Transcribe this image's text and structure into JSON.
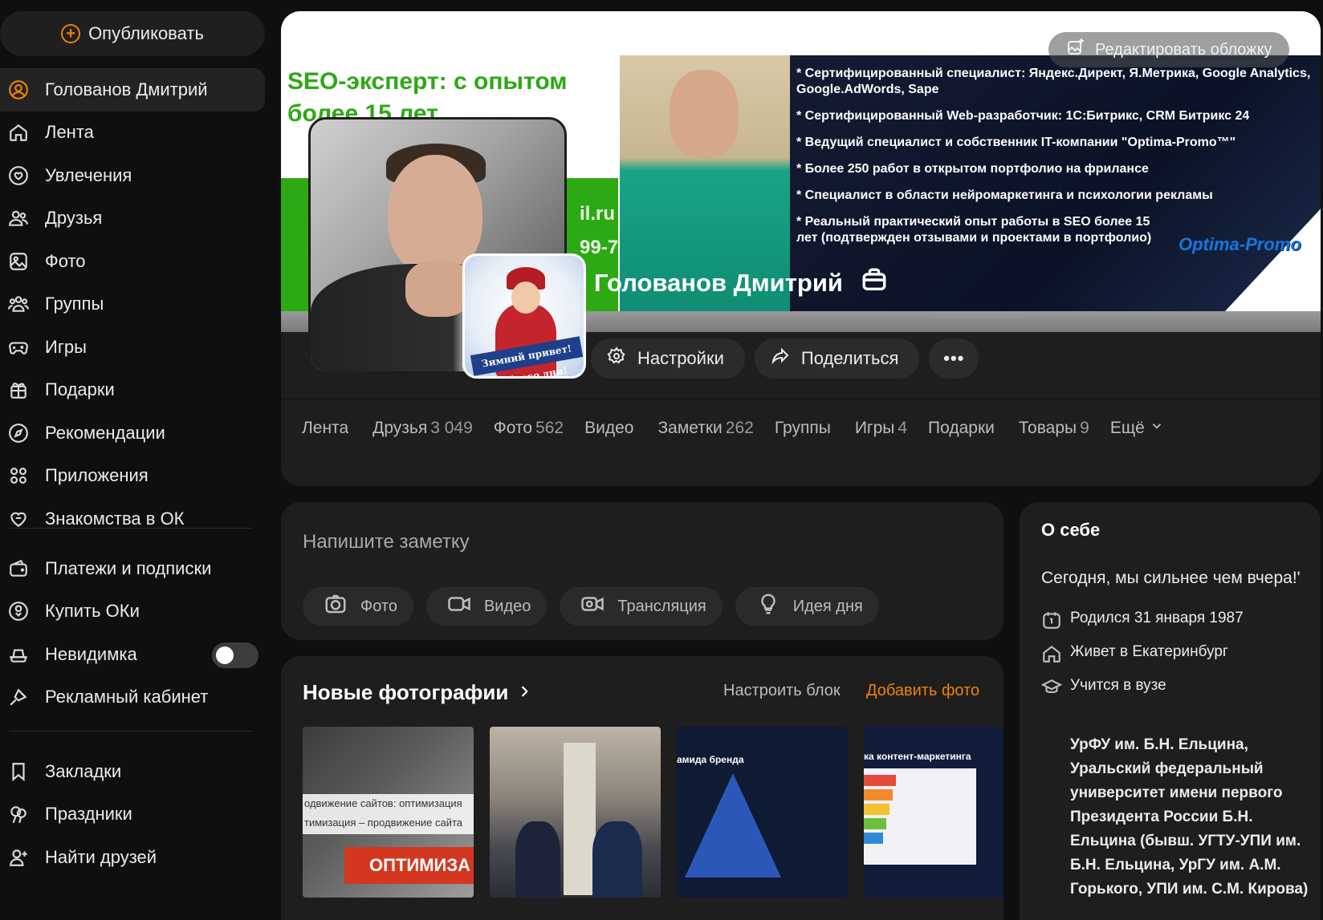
{
  "sidebar": {
    "publish_label": "Опубликовать",
    "items_main": [
      {
        "label": "Голованов Дмитрий",
        "icon": "user-icon"
      },
      {
        "label": "Лента",
        "icon": "home-icon"
      },
      {
        "label": "Увлечения",
        "icon": "hobbies-icon"
      },
      {
        "label": "Друзья",
        "icon": "friends-icon"
      },
      {
        "label": "Фото",
        "icon": "photo-icon"
      },
      {
        "label": "Группы",
        "icon": "groups-icon"
      },
      {
        "label": "Игры",
        "icon": "gamepad-icon"
      },
      {
        "label": "Подарки",
        "icon": "gift-icon"
      },
      {
        "label": "Рекомендации",
        "icon": "compass-icon"
      },
      {
        "label": "Приложения",
        "icon": "apps-icon"
      },
      {
        "label": "Знакомства в ОК",
        "icon": "dating-icon"
      }
    ],
    "items_services": [
      {
        "label": "Платежи и подписки",
        "icon": "wallet-icon"
      },
      {
        "label": "Купить ОКи",
        "icon": "coin-icon"
      },
      {
        "label": "Невидимка",
        "icon": "incognito-icon",
        "toggle_on": false
      },
      {
        "label": "Рекламный кабинет",
        "icon": "ads-icon"
      }
    ],
    "items_extra": [
      {
        "label": "Закладки",
        "icon": "bookmark-icon"
      },
      {
        "label": "Праздники",
        "icon": "balloons-icon"
      },
      {
        "label": "Найти друзей",
        "icon": "add-friend-icon"
      }
    ]
  },
  "cover": {
    "edit_label": "Редактировать обложку",
    "seo_title": "SEO-эксперт: с опытом более 15 лет",
    "email_fragment": "il.ru",
    "phone_fragment": "99-7",
    "bullets_1": "* Сертифицированный специалист: Яндекс.Директ, Я.Метрика, Google Analytics, Google.AdWords, Sape",
    "bullets_2": "* Сертифицированный Web-разработчик: 1С:Битрикс, CRM Битрикс 24",
    "bullets_3": "* Ведущий специалист и собственник IT-компании \"Optima-Promo™\"",
    "bullets_4": "* Более 250 работ в открытом портфолио на фрилансе",
    "bullets_5": "* Специалист в области нейромаркетинга и психологии рекламы",
    "bullets_6": "* Реальный практический опыт работы в SEO более 15 лет (подтвержден отзывами и проектами в портфолио)",
    "logo_text": "Optima-Promo",
    "sticker_text": "Зимний привет! Доброго дня!"
  },
  "profile": {
    "name": "Голованов Дмитрий",
    "settings_label": "Настройки",
    "share_label": "Поделиться",
    "more_label": "•••"
  },
  "tabs": [
    {
      "label": "Лента",
      "count": ""
    },
    {
      "label": "Друзья",
      "count": "3 049"
    },
    {
      "label": "Фото",
      "count": "562"
    },
    {
      "label": "Видео",
      "count": ""
    },
    {
      "label": "Заметки",
      "count": "262"
    },
    {
      "label": "Группы",
      "count": ""
    },
    {
      "label": "Игры",
      "count": "4"
    },
    {
      "label": "Подарки",
      "count": ""
    },
    {
      "label": "Товары",
      "count": "9"
    }
  ],
  "tabs_more_label": "Ещё",
  "composer": {
    "placeholder": "Напишите заметку",
    "buttons": [
      "Фото",
      "Видео",
      "Трансляция",
      "Идея дня"
    ]
  },
  "photos_block": {
    "title": "Новые фотографии",
    "configure_label": "Настроить блок",
    "add_label": "Добавить фото",
    "thumb1_text1": "одвижение сайтов: оптимизация",
    "thumb1_text2": "тимизация – продвижение сайта",
    "thumb1_red": "ОПТИМИЗА",
    "thumb3_title": "амида бренда",
    "thumb4_title": "ка контент-маркетинга"
  },
  "about": {
    "title": "О себе",
    "quote": "Сегодня, мы сильнее чем вчера!'",
    "born": "Родился 31 января 1987",
    "lives": "Живет в Екатеринбург",
    "studies": "Учится в вузе",
    "university": "УрФУ им. Б.Н. Ельцина, Уральский федеральный университет имени первого Президента России Б.Н. Ельцина (бывш. УГТУ-УПИ им. Б.Н. Ельцина, УрГУ им. А.М. Горького, УПИ им. С.М. Кирова)"
  },
  "colors": {
    "accent": "#ee8208",
    "background": "#0f0f0f",
    "card": "#1e1e1e"
  }
}
